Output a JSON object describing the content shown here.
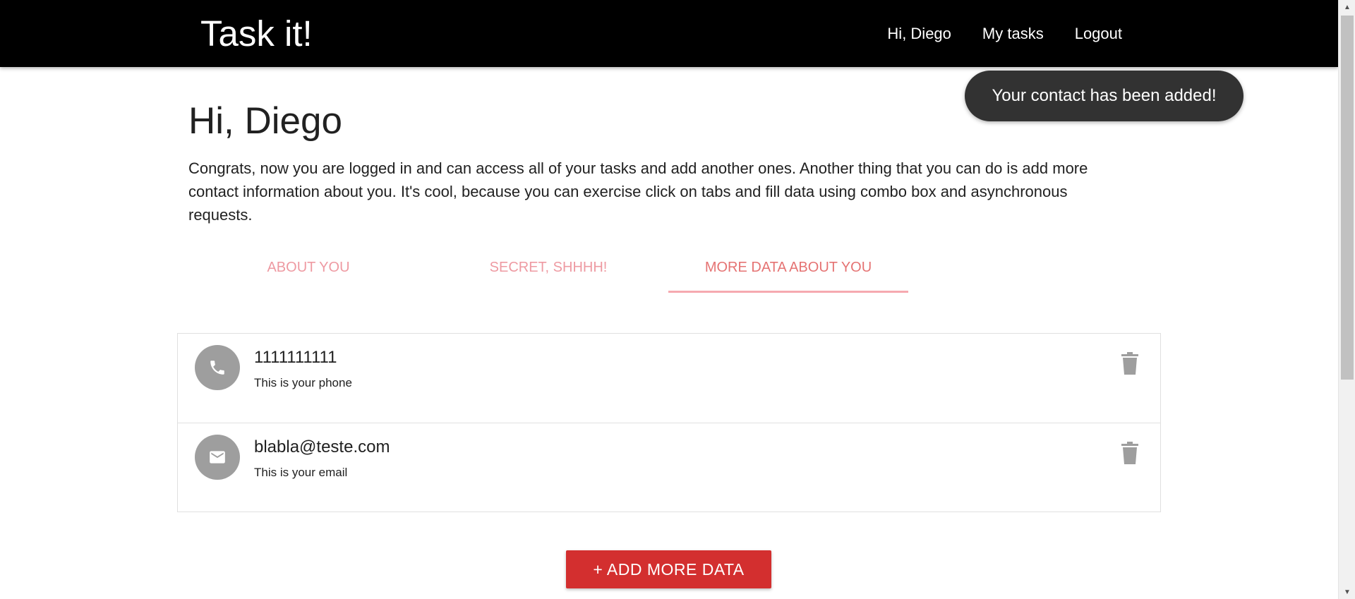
{
  "navbar": {
    "brand": "Task it!",
    "links": [
      "Hi, Diego",
      "My tasks",
      "Logout"
    ]
  },
  "toast": "Your contact has been added!",
  "page": {
    "title": "Hi, Diego",
    "intro": "Congrats, now you are logged in and can access all of your tasks and add another ones. Another thing that you can do is add more contact information about you. It's cool, because you can exercise click on tabs and fill data using combo box and asynchronous requests."
  },
  "tabs": [
    {
      "label": "ABOUT YOU",
      "active": false
    },
    {
      "label": "SECRET, SHHHH!",
      "active": false
    },
    {
      "label": "MORE DATA ABOUT YOU",
      "active": true
    }
  ],
  "contacts": [
    {
      "icon": "phone-icon",
      "value": "1111111111",
      "description": "This is your phone"
    },
    {
      "icon": "email-icon",
      "value": "blabla@teste.com",
      "description": "This is your email"
    }
  ],
  "add_button": "+ ADD MORE DATA",
  "colors": {
    "navbar": "#000000",
    "tab_text": "#ee9aa2",
    "tab_indicator": "#f6a9b0",
    "button": "#d32f2f",
    "toast": "#323232",
    "avatar": "#9e9e9e"
  }
}
